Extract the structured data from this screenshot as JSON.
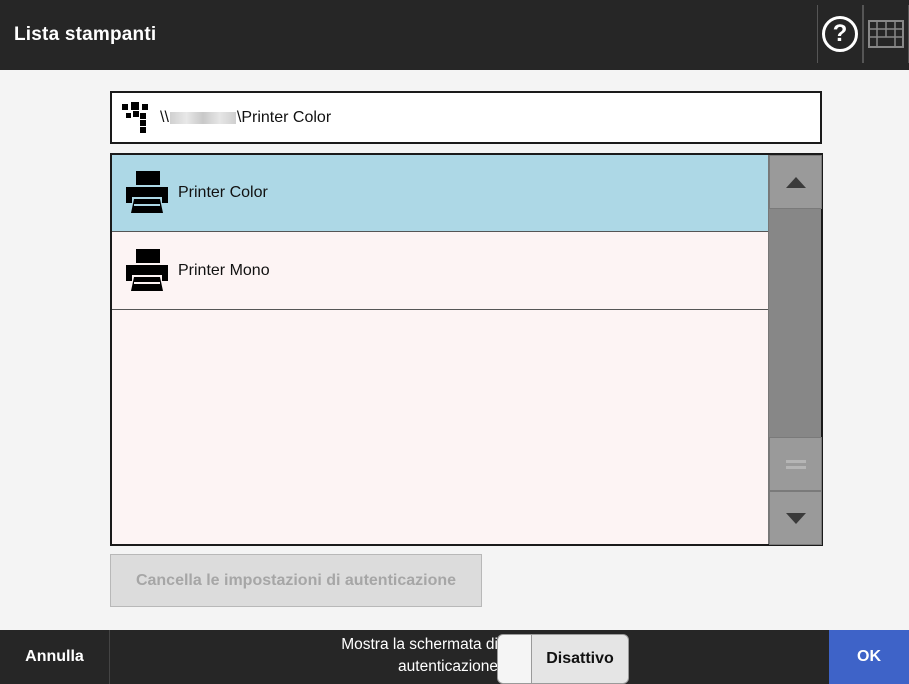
{
  "header": {
    "title": "Lista stampanti",
    "help_icon": "help-icon",
    "keyboard_icon": "keyboard-icon"
  },
  "path_field": {
    "prefix": "\\\\",
    "suffix": "\\Printer Color",
    "icon": "network-icon"
  },
  "printers": [
    {
      "name": "Printer Color",
      "selected": true,
      "icon": "printer-icon"
    },
    {
      "name": "Printer Mono",
      "selected": false,
      "icon": "printer-icon"
    }
  ],
  "clear_auth_button": "Cancella le impostazioni di autenticazione",
  "footer": {
    "cancel_label": "Annulla",
    "toggle_label_line1": "Mostra la schermata di",
    "toggle_label_line2": "autenticazione",
    "toggle_state": "Disattivo",
    "ok_label": "OK"
  },
  "colors": {
    "header_bg": "#262626",
    "selected_row": "#add8e6",
    "list_bg": "#fdf4f4",
    "ok_bg": "#3e63c8"
  }
}
